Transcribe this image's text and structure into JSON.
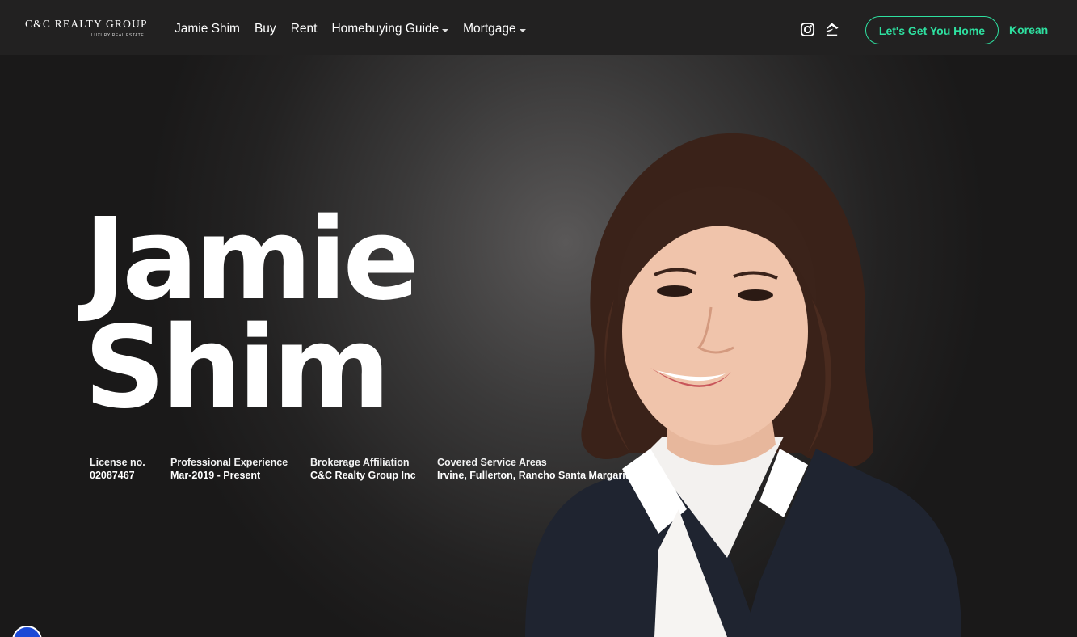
{
  "nav": {
    "logo_main": "C&C REALTY GROUP",
    "logo_sub": "LUXURY REAL ESTATE",
    "menu": [
      {
        "label": "Jamie Shim"
      },
      {
        "label": "Buy"
      },
      {
        "label": "Rent"
      },
      {
        "label": "Homebuying Guide"
      },
      {
        "label": "Mortgage"
      }
    ],
    "cta_label": "Let's Get You Home",
    "language_label": "Korean"
  },
  "hero": {
    "first_name": "Jamie",
    "last_name": "Shim",
    "details": [
      {
        "label": "License no.",
        "value": "02087467"
      },
      {
        "label": "Professional Experience",
        "value": "Mar-2019 - Present"
      },
      {
        "label": "Brokerage Affiliation",
        "value": "C&C Realty Group Inc"
      },
      {
        "label": "Covered Service Areas",
        "value": "Irvine, Fullerton, Rancho Santa Margarita"
      }
    ]
  },
  "colors": {
    "accent": "#2ee0a0",
    "nav_bg": "#222121",
    "hero_bg": "#2a2929",
    "a11y_badge": "#1a49d6"
  },
  "icons": [
    "instagram-icon",
    "zillow-icon",
    "accessibility-icon",
    "chevron-down-icon"
  ]
}
